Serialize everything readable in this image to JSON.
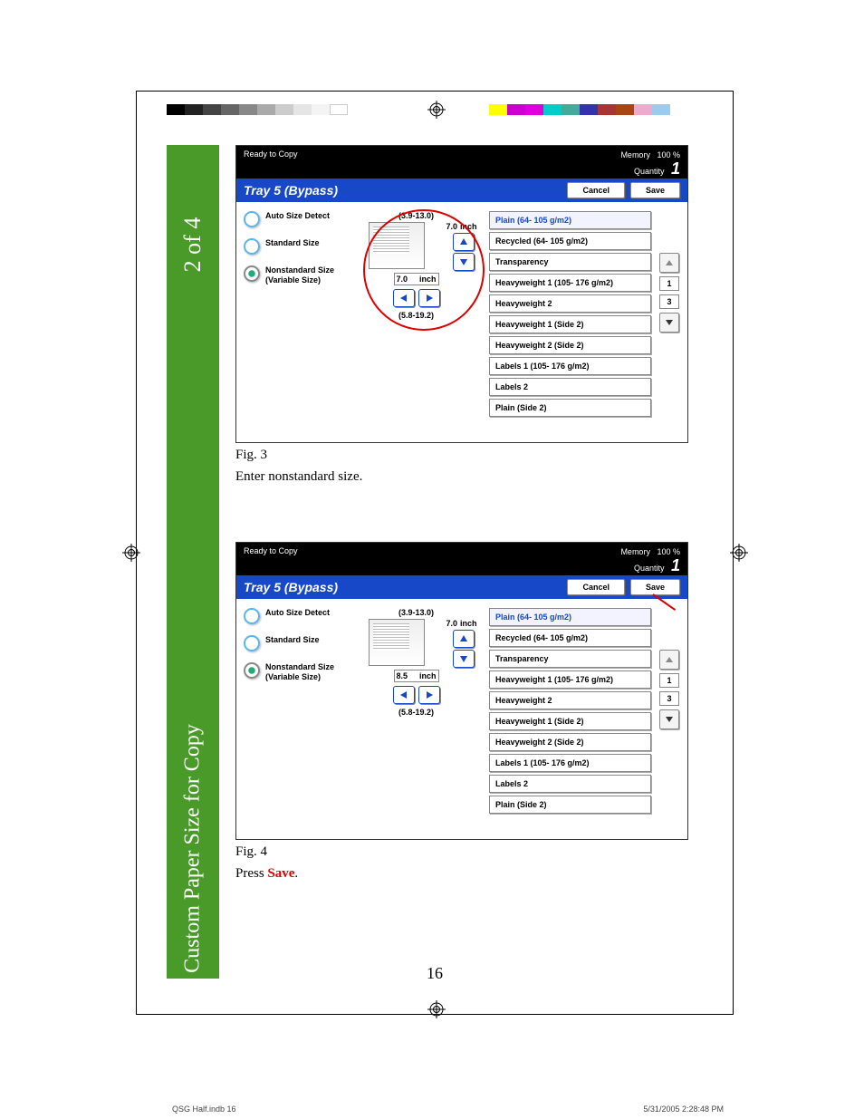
{
  "page": {
    "number": "16",
    "footer_left": "QSG Half.indb   16",
    "footer_right": "5/31/2005   2:28:48 PM"
  },
  "sidebar": {
    "step_counter": "2 of 4",
    "section_title": "Custom Paper Size for Copy"
  },
  "fig3": {
    "label": "Fig. 3",
    "caption": "Enter nonstandard size.",
    "lcd": {
      "status": "Ready to Copy",
      "memory_label": "Memory",
      "memory_value": "100 %",
      "quantity_label": "Quantity",
      "quantity_value": "1",
      "title": "Tray 5 (Bypass)",
      "cancel": "Cancel",
      "save": "Save",
      "options": {
        "auto": "Auto Size Detect",
        "standard": "Standard Size",
        "nonstd_line1": "Nonstandard Size",
        "nonstd_line2": "(Variable Size)"
      },
      "diagram": {
        "y_range": "(3.9-13.0)",
        "y_value": "7.0",
        "unit": "inch",
        "x_value": "7.0",
        "x_unit": "inch",
        "x_range": "(5.8-19.2)"
      },
      "paper_types": [
        "Plain (64- 105 g/m2)",
        "Recycled (64- 105 g/m2)",
        "Transparency",
        "Heavyweight 1 (105- 176 g/m2)",
        "Heavyweight 2",
        "Heavyweight 1 (Side 2)",
        "Heavyweight 2 (Side 2)",
        "Labels 1 (105- 176 g/m2)",
        "Labels 2",
        "Plain (Side 2)"
      ],
      "scroll_top": "1",
      "scroll_bottom": "3"
    }
  },
  "fig4": {
    "label": "Fig. 4",
    "caption_prefix": "Press ",
    "caption_bold": "Save",
    "caption_suffix": ".",
    "lcd": {
      "status": "Ready to Copy",
      "memory_label": "Memory",
      "memory_value": "100 %",
      "quantity_label": "Quantity",
      "quantity_value": "1",
      "title": "Tray 5 (Bypass)",
      "cancel": "Cancel",
      "save": "Save",
      "options": {
        "auto": "Auto Size Detect",
        "standard": "Standard Size",
        "nonstd_line1": "Nonstandard Size",
        "nonstd_line2": "(Variable Size)"
      },
      "diagram": {
        "y_range": "(3.9-13.0)",
        "y_value": "7.0",
        "unit": "inch",
        "x_value": "8.5",
        "x_unit": "inch",
        "x_range": "(5.8-19.2)"
      },
      "paper_types": [
        "Plain (64- 105 g/m2)",
        "Recycled (64- 105 g/m2)",
        "Transparency",
        "Heavyweight 1 (105- 176 g/m2)",
        "Heavyweight 2",
        "Heavyweight 1 (Side 2)",
        "Heavyweight 2 (Side 2)",
        "Labels 1 (105- 176 g/m2)",
        "Labels 2",
        "Plain (Side 2)"
      ],
      "scroll_top": "1",
      "scroll_bottom": "3"
    }
  }
}
